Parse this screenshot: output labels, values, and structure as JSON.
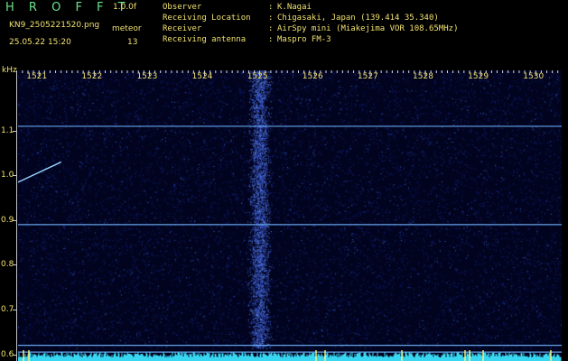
{
  "header": {
    "logo": "H R O F F T",
    "version": "1.0.0f",
    "filename": "KN9_2505221520.png",
    "datetime": "25.05.22 15:20",
    "source_label": "meteor",
    "source_value": "13"
  },
  "info": [
    {
      "key": "Observer",
      "value": "K.Nagai"
    },
    {
      "key": "Receiving Location",
      "value": "Chigasaki, Japan (139.414 35.340)"
    },
    {
      "key": "Receiver",
      "value": "AirSpy mini (Miakejima VOR 108.65MHz)"
    },
    {
      "key": "Receiving antenna",
      "value": "Maspro FM-3"
    }
  ],
  "info_colon": ":",
  "colors": {
    "background": "#02041f",
    "label": "#f0e070",
    "logo": "#6de08a",
    "signal": "#6fb4ff",
    "noise_bar": "#39d6f2",
    "noise_peak": "#f5f07a"
  },
  "chart_data": {
    "type": "heatmap",
    "yunit_label": "kHz",
    "y_ticks": [
      "1.1",
      "1.0",
      "0.9",
      "0.8",
      "0.7",
      "0.6"
    ],
    "ylim": [
      0.585,
      1.235
    ],
    "x_ticks": [
      "1521",
      "1522",
      "1523",
      "1524",
      "1525",
      "1526",
      "1527",
      "1528",
      "1529",
      "1530"
    ],
    "xlim": [
      1520.62,
      1530.47
    ],
    "horizontal_lines": [
      1.11,
      0.89,
      0.62,
      0.605
    ],
    "meteor_streak": {
      "x_start": 1520.62,
      "y_start": 0.985,
      "x_end": 1521.4,
      "y_end": 1.03
    },
    "noise_column_center": 1525.0,
    "noise_column_halfwidth": 0.12
  }
}
